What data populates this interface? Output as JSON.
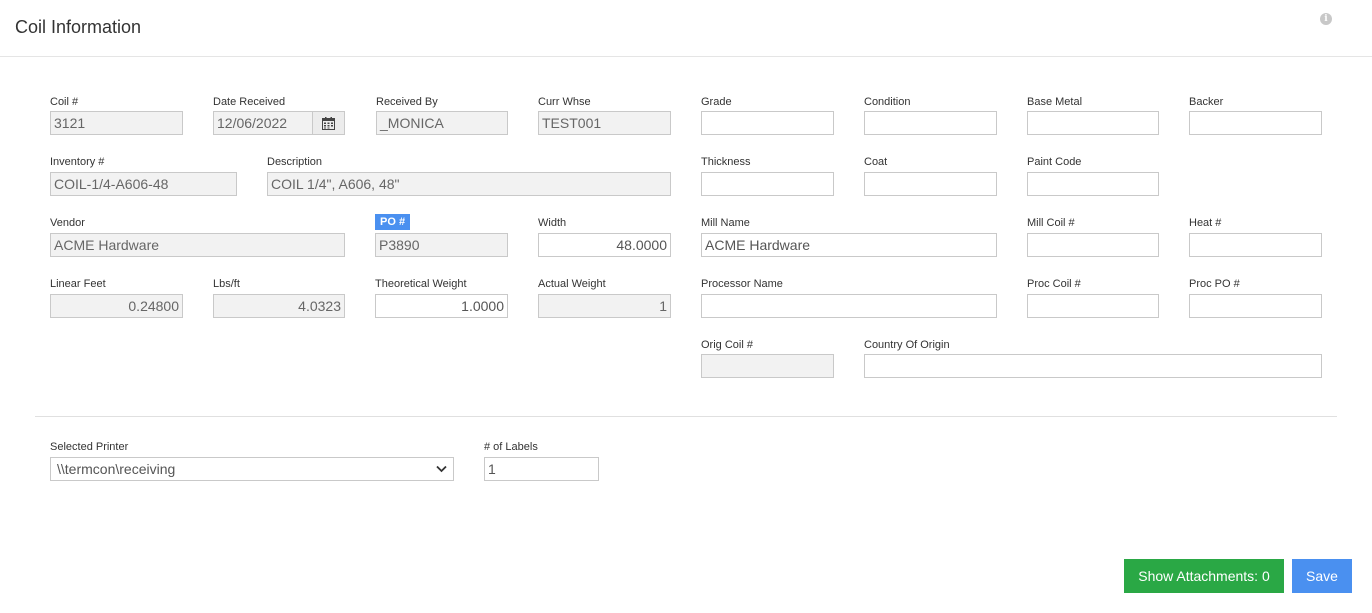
{
  "header": {
    "title": "Coil Information",
    "info_icon": "info-icon"
  },
  "fields": {
    "coil_no": {
      "label": "Coil #",
      "value": "3121"
    },
    "date_received": {
      "label": "Date Received",
      "value": "12/06/2022",
      "icon": "calendar-icon"
    },
    "received_by": {
      "label": "Received By",
      "value": "_MONICA"
    },
    "curr_whse": {
      "label": "Curr Whse",
      "value": "TEST001"
    },
    "grade": {
      "label": "Grade",
      "value": ""
    },
    "condition": {
      "label": "Condition",
      "value": ""
    },
    "base_metal": {
      "label": "Base Metal",
      "value": ""
    },
    "backer": {
      "label": "Backer",
      "value": ""
    },
    "inventory_no": {
      "label": "Inventory #",
      "value": "COIL-1/4-A606-48"
    },
    "description": {
      "label": "Description",
      "value": "COIL 1/4\", A606, 48\""
    },
    "thickness": {
      "label": "Thickness",
      "value": ""
    },
    "coat": {
      "label": "Coat",
      "value": ""
    },
    "paint_code": {
      "label": "Paint Code",
      "value": ""
    },
    "vendor": {
      "label": "Vendor",
      "value": "ACME Hardware"
    },
    "po_no": {
      "label": "PO #",
      "value": "P3890"
    },
    "width": {
      "label": "Width",
      "value": "48.0000"
    },
    "mill_name": {
      "label": "Mill Name",
      "value": "ACME Hardware"
    },
    "mill_coil_no": {
      "label": "Mill Coil #",
      "value": ""
    },
    "heat_no": {
      "label": "Heat #",
      "value": ""
    },
    "linear_feet": {
      "label": "Linear Feet",
      "value": "0.24800"
    },
    "lbs_ft": {
      "label": "Lbs/ft",
      "value": "4.0323"
    },
    "theoretical_weight": {
      "label": "Theoretical Weight",
      "value": "1.0000"
    },
    "actual_weight": {
      "label": "Actual Weight",
      "value": "1"
    },
    "processor_name": {
      "label": "Processor Name",
      "value": ""
    },
    "proc_coil_no": {
      "label": "Proc Coil #",
      "value": ""
    },
    "proc_po_no": {
      "label": "Proc PO #",
      "value": ""
    },
    "orig_coil_no": {
      "label": "Orig Coil #",
      "value": ""
    },
    "country_of_origin": {
      "label": "Country Of Origin",
      "value": ""
    }
  },
  "printing": {
    "printer": {
      "label": "Selected Printer",
      "value": "\\\\termcon\\receiving"
    },
    "labels": {
      "label": "# of Labels",
      "value": "1"
    }
  },
  "buttons": {
    "show_attachments": "Show Attachments: 0",
    "save": "Save"
  },
  "colors": {
    "accent_blue": "#4a90f0",
    "success_green": "#2aa845",
    "readonly_bg": "#f2f2f2"
  }
}
